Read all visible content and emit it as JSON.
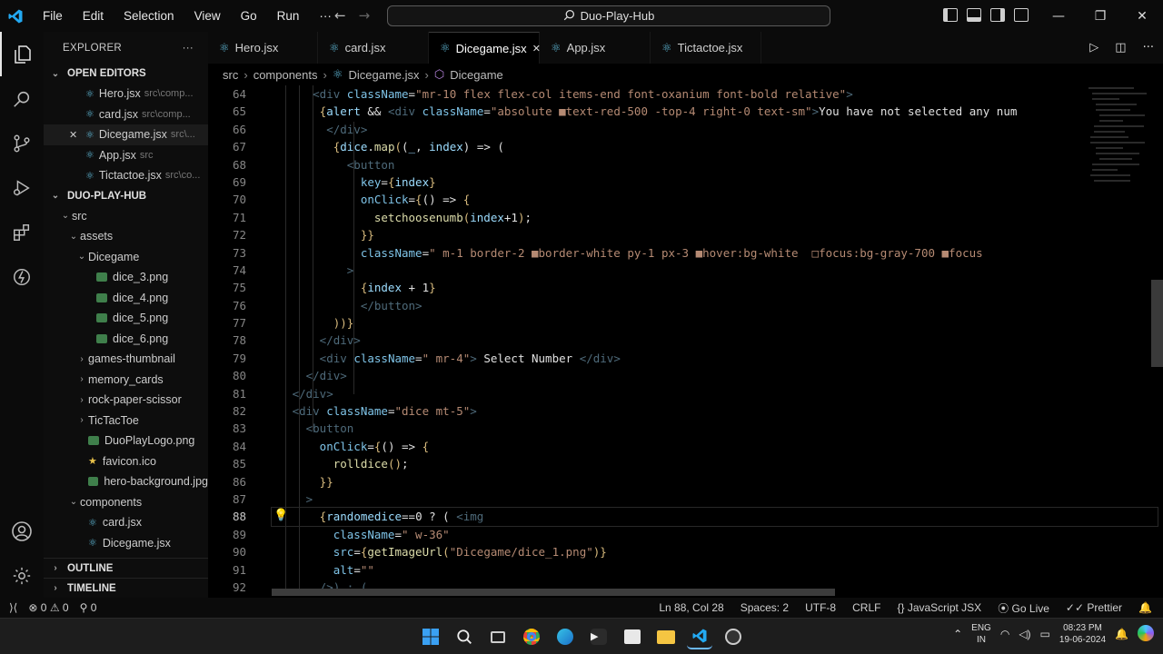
{
  "menu": [
    "File",
    "Edit",
    "Selection",
    "View",
    "Go",
    "Run",
    "···"
  ],
  "search_text": "Duo-Play-Hub",
  "explorer": {
    "title": "EXPLORER",
    "more": "···",
    "open_editors_label": "OPEN EDITORS",
    "open_editors": [
      {
        "name": "Hero.jsx",
        "desc": "src\\comp...",
        "close": ""
      },
      {
        "name": "card.jsx",
        "desc": "src\\comp...",
        "close": ""
      },
      {
        "name": "Dicegame.jsx",
        "desc": "src\\...",
        "close": "✕"
      },
      {
        "name": "App.jsx",
        "desc": "src",
        "close": ""
      },
      {
        "name": "Tictactoe.jsx",
        "desc": "src\\co...",
        "close": ""
      }
    ],
    "project_label": "DUO-PLAY-HUB",
    "tree": [
      {
        "name": "src",
        "chev": "⌄",
        "type": "folder"
      },
      {
        "name": "assets",
        "chev": "⌄",
        "type": "folder"
      },
      {
        "name": "Dicegame",
        "chev": "⌄",
        "type": "folder"
      },
      {
        "name": "dice_3.png",
        "chev": "",
        "type": "img"
      },
      {
        "name": "dice_4.png",
        "chev": "",
        "type": "img"
      },
      {
        "name": "dice_5.png",
        "chev": "",
        "type": "img"
      },
      {
        "name": "dice_6.png",
        "chev": "",
        "type": "img"
      },
      {
        "name": "games-thumbnail",
        "chev": "›",
        "type": "folder"
      },
      {
        "name": "memory_cards",
        "chev": "›",
        "type": "folder"
      },
      {
        "name": "rock-paper-scissor",
        "chev": "›",
        "type": "folder"
      },
      {
        "name": "TicTacToe",
        "chev": "›",
        "type": "folder"
      },
      {
        "name": "DuoPlayLogo.png",
        "chev": "",
        "type": "img"
      },
      {
        "name": "favicon.ico",
        "chev": "",
        "type": "star"
      },
      {
        "name": "hero-background.jpg",
        "chev": "",
        "type": "img"
      },
      {
        "name": "components",
        "chev": "⌄",
        "type": "folder"
      },
      {
        "name": "card.jsx",
        "chev": "",
        "type": "jsx"
      },
      {
        "name": "Dicegame.jsx",
        "chev": "",
        "type": "jsx"
      }
    ],
    "outline_label": "OUTLINE",
    "timeline_label": "TIMELINE"
  },
  "tabs": [
    {
      "label": "Hero.jsx",
      "close": ""
    },
    {
      "label": "card.jsx",
      "close": ""
    },
    {
      "label": "Dicegame.jsx",
      "close": "✕"
    },
    {
      "label": "App.jsx",
      "close": ""
    },
    {
      "label": "Tictactoe.jsx",
      "close": ""
    }
  ],
  "breadcrumb": [
    "src",
    "components",
    "Dicegame.jsx",
    "Dicegame"
  ],
  "line_numbers": [
    "64",
    "65",
    "66",
    "67",
    "68",
    "69",
    "70",
    "71",
    "72",
    "73",
    "74",
    "75",
    "76",
    "77",
    "78",
    "79",
    "80",
    "81",
    "82",
    "83",
    "84",
    "85",
    "86",
    "87",
    "88",
    "89",
    "90",
    "91",
    "92"
  ],
  "current_line": "88",
  "code_lines": [
    [
      [
        "t-tag",
        "      <div "
      ],
      [
        "t-attr",
        "className"
      ],
      [
        "t-txt",
        "="
      ],
      [
        "t-str",
        "\"mr-10 flex flex-col items-end font-oxanium font-bold relative\""
      ],
      [
        "t-tag",
        ">"
      ]
    ],
    [
      [
        "t-br",
        "       {"
      ],
      [
        "t-var",
        "alert"
      ],
      [
        "t-txt",
        " && "
      ],
      [
        "t-tag",
        "<div "
      ],
      [
        "t-attr",
        "className"
      ],
      [
        "t-txt",
        "="
      ],
      [
        "t-str",
        "\"absolute ■text-red-500 -top-4 right-0 text-sm\""
      ],
      [
        "t-tag",
        ">"
      ],
      [
        "t-txt",
        "You have not selected any num"
      ]
    ],
    [
      [
        "t-tag",
        "        </div>"
      ]
    ],
    [
      [
        "t-br",
        "         {"
      ],
      [
        "t-var",
        "dice"
      ],
      [
        "t-txt",
        "."
      ],
      [
        "t-fn",
        "map"
      ],
      [
        "t-br",
        "("
      ],
      [
        "t-txt",
        "("
      ],
      [
        "t-var",
        "_"
      ],
      [
        "t-txt",
        ", "
      ],
      [
        "t-var",
        "index"
      ],
      [
        "t-txt",
        ") => ("
      ]
    ],
    [
      [
        "t-tag",
        "           <button"
      ]
    ],
    [
      [
        "t-attr",
        "             key"
      ],
      [
        "t-txt",
        "="
      ],
      [
        "t-br",
        "{"
      ],
      [
        "t-var",
        "index"
      ],
      [
        "t-br",
        "}"
      ]
    ],
    [
      [
        "t-attr",
        "             onClick"
      ],
      [
        "t-txt",
        "="
      ],
      [
        "t-br",
        "{"
      ],
      [
        "t-txt",
        "() => "
      ],
      [
        "t-br",
        "{"
      ]
    ],
    [
      [
        "t-fn",
        "               setchoosenumb"
      ],
      [
        "t-br",
        "("
      ],
      [
        "t-var",
        "index"
      ],
      [
        "t-txt",
        "+1"
      ],
      [
        "t-br",
        ")"
      ],
      [
        "t-txt",
        ";"
      ]
    ],
    [
      [
        "t-br",
        "             }}"
      ]
    ],
    [
      [
        "t-attr",
        "             className"
      ],
      [
        "t-txt",
        "="
      ],
      [
        "t-str",
        "\" m-1 border-2 ■border-white py-1 px-3 ■hover:bg-white  □focus:bg-gray-700 ■focus"
      ]
    ],
    [
      [
        "t-tag",
        "           >"
      ]
    ],
    [
      [
        "t-br",
        "             {"
      ],
      [
        "t-var",
        "index"
      ],
      [
        "t-txt",
        " + 1"
      ],
      [
        "t-br",
        "}"
      ]
    ],
    [
      [
        "t-tag",
        "             </button>"
      ]
    ],
    [
      [
        "t-br",
        "         ))}"
      ]
    ],
    [
      [
        "t-tag",
        "       </div>"
      ]
    ],
    [
      [
        "t-tag",
        "       <div "
      ],
      [
        "t-attr",
        "className"
      ],
      [
        "t-txt",
        "="
      ],
      [
        "t-str",
        "\" mr-4\""
      ],
      [
        "t-tag",
        ">"
      ],
      [
        "t-txt",
        " Select Number "
      ],
      [
        "t-tag",
        "</div>"
      ]
    ],
    [
      [
        "t-tag",
        "     </div>"
      ]
    ],
    [
      [
        "t-tag",
        "   </div>"
      ]
    ],
    [
      [
        "t-tag",
        "   <div "
      ],
      [
        "t-attr",
        "className"
      ],
      [
        "t-txt",
        "="
      ],
      [
        "t-str",
        "\"dice mt-5\""
      ],
      [
        "t-tag",
        ">"
      ]
    ],
    [
      [
        "t-tag",
        "     <button"
      ]
    ],
    [
      [
        "t-attr",
        "       onClick"
      ],
      [
        "t-txt",
        "="
      ],
      [
        "t-br",
        "{"
      ],
      [
        "t-txt",
        "() => "
      ],
      [
        "t-br",
        "{"
      ]
    ],
    [
      [
        "t-fn",
        "         rolldice"
      ],
      [
        "t-br",
        "("
      ],
      [
        "t-br",
        ")"
      ],
      [
        "t-txt",
        ";"
      ]
    ],
    [
      [
        "t-br",
        "       }}"
      ]
    ],
    [
      [
        "t-tag",
        "     >"
      ]
    ],
    [
      [
        "t-br",
        "       {"
      ],
      [
        "t-var",
        "randomedice"
      ],
      [
        "t-txt",
        "==0"
      ],
      [
        "t-txt",
        " ? ( "
      ],
      [
        "t-tag",
        "<img"
      ]
    ],
    [
      [
        "t-attr",
        "         className"
      ],
      [
        "t-txt",
        "="
      ],
      [
        "t-str",
        "\" w-36\""
      ]
    ],
    [
      [
        "t-attr",
        "         src"
      ],
      [
        "t-txt",
        "="
      ],
      [
        "t-br",
        "{"
      ],
      [
        "t-fn",
        "getImageUrl"
      ],
      [
        "t-br",
        "("
      ],
      [
        "t-str",
        "\"Dicegame/dice_1.png\""
      ],
      [
        "t-br",
        ")}"
      ]
    ],
    [
      [
        "t-attr",
        "         alt"
      ],
      [
        "t-txt",
        "="
      ],
      [
        "t-str",
        "\"\""
      ]
    ],
    [
      [
        "t-tag",
        "       />) : ("
      ]
    ]
  ],
  "status": {
    "remote": "⟩⟨",
    "errors": "0",
    "warnings": "0",
    "ports": "0",
    "position": "Ln 88, Col 28",
    "spaces": "Spaces: 2",
    "encoding": "UTF-8",
    "eol": "CRLF",
    "language": "JavaScript JSX",
    "golive": "Go Live",
    "prettier": "Prettier"
  },
  "taskbar": {
    "lang_top": "ENG",
    "lang_bottom": "IN",
    "time": "08:23 PM",
    "date": "19-06-2024"
  },
  "colors": {
    "accent": "#0078d4",
    "jsx_icon": "#5fb8d6",
    "vscode_blue": "#23a9f2"
  }
}
